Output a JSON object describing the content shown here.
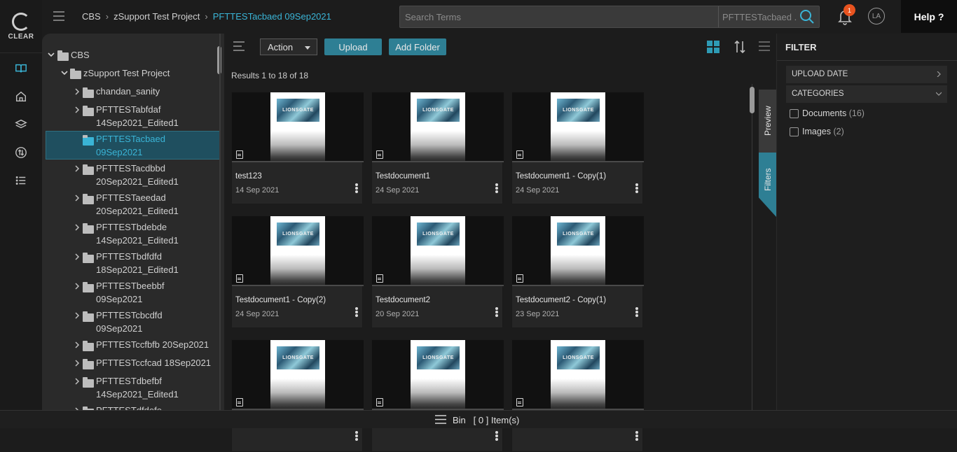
{
  "logo": {
    "text": "CLEAR"
  },
  "breadcrumb": [
    "CBS",
    "zSupport Test Project",
    "PFTTESTacbaed 09Sep2021"
  ],
  "search": {
    "placeholder": "Search Terms",
    "scope": "PFTTESTacbaed ..."
  },
  "notifications": {
    "count": "1"
  },
  "user": {
    "initials": "LA"
  },
  "help_label": "Help ?",
  "tree": {
    "root": "CBS",
    "project": "zSupport Test Project",
    "folders": [
      [
        "chandan_sanity"
      ],
      [
        "PFTTESTabfdaf",
        "14Sep2021_Edited1"
      ],
      [
        "PFTTESTacbaed",
        "09Sep2021"
      ],
      [
        "PFTTESTacdbbd",
        "20Sep2021_Edited1"
      ],
      [
        "PFTTESTaeedad",
        "20Sep2021_Edited1"
      ],
      [
        "PFTTESTbdebde",
        "14Sep2021_Edited1"
      ],
      [
        "PFTTESTbdfdfd",
        "18Sep2021_Edited1"
      ],
      [
        "PFTTESTbeebbf",
        "09Sep2021"
      ],
      [
        "PFTTESTcbcdfd",
        "09Sep2021"
      ],
      [
        "PFTTESTccfbfb 20Sep2021"
      ],
      [
        "PFTTESTccfcad 18Sep2021"
      ],
      [
        "PFTTESTdbefbf",
        "14Sep2021_Edited1"
      ],
      [
        "PFTTESTdfdefe",
        "..."
      ]
    ]
  },
  "toolbar": {
    "action_label": "Action",
    "upload_label": "Upload",
    "add_folder_label": "Add Folder"
  },
  "results_text": "Results 1 to 18 of 18",
  "thumb_brand": "LIONSGATE",
  "cards": [
    {
      "title": "test123",
      "date": "14 Sep 2021"
    },
    {
      "title": "Testdocument1",
      "date": "24 Sep 2021"
    },
    {
      "title": "Testdocument1 - Copy(1)",
      "date": "24 Sep 2021"
    },
    {
      "title": "Testdocument1 - Copy(2)",
      "date": "24 Sep 2021"
    },
    {
      "title": "Testdocument2",
      "date": "20 Sep 2021"
    },
    {
      "title": "Testdocument2 - Copy(1)",
      "date": "23 Sep 2021"
    },
    {
      "title": "",
      "date": ""
    },
    {
      "title": "",
      "date": ""
    },
    {
      "title": "",
      "date": ""
    }
  ],
  "side_tabs": {
    "preview": "Preview",
    "filters": "Filters"
  },
  "filter": {
    "title": "FILTER",
    "sections": [
      "UPLOAD DATE",
      "CATEGORIES"
    ],
    "options": [
      {
        "label": "Documents",
        "count": "(16)"
      },
      {
        "label": "Images",
        "count": "(2)"
      }
    ]
  },
  "bin": {
    "label": "Bin",
    "items": "[ 0 ] Item(s)"
  },
  "colors": {
    "accent": "#2e7f94",
    "link": "#3ab4d6",
    "selected_bg": "#1f4f5f",
    "badge": "#e8531f"
  }
}
